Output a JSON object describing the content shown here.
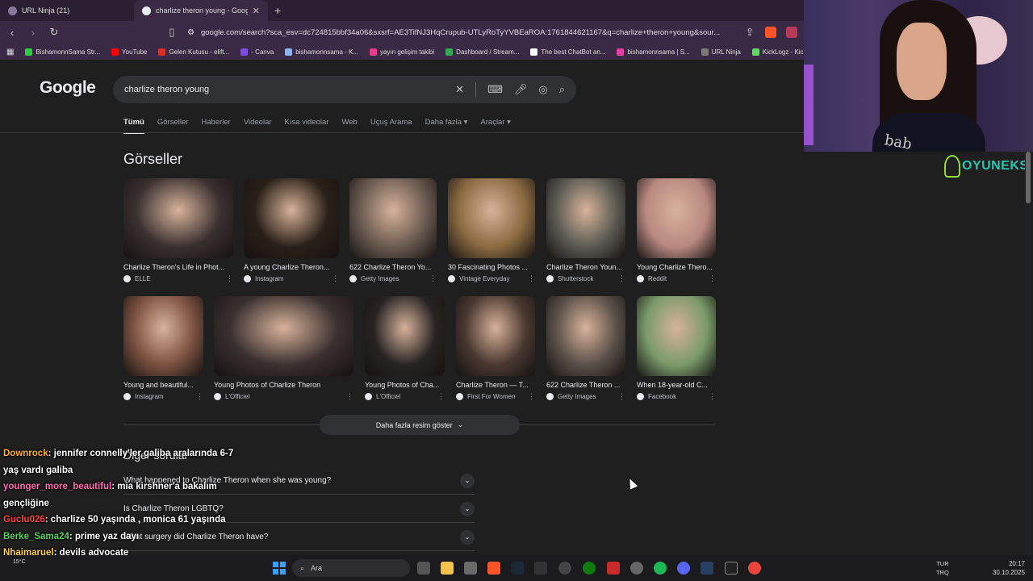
{
  "browser": {
    "tabs": [
      {
        "label": "URL Ninja (21)",
        "active": false
      },
      {
        "label": "charlize theron young - Google",
        "active": true
      }
    ],
    "url": "google.com/search?sca_esv=dc724815bbf34a06&sxsrf=AE3TifNJ3HqCrupub-UTLyRoTyYVBEaROA:1761844621167&q=charlize+theron+young&sour...",
    "bookmarks": [
      "BishamonnSama Str...",
      "YouTube",
      "Gelen Kutusu - elift...",
      "- Canva",
      "bishamonnsama - K...",
      "yayın gelişim takibi",
      "Dashboard / Stream...",
      "The best ChatBot an...",
      "bishamonnsama | S...",
      "URL Ninja",
      "KickLogz - Kick Yay"
    ],
    "bookmark_colors": [
      "#2ecc40",
      "#ff0000",
      "#d93025",
      "#7b4de0",
      "#8ab4f8",
      "#e83e8c",
      "#34a853",
      "#ffffff",
      "#e040a0",
      "#7a7a7a",
      "#6bd36b"
    ]
  },
  "google": {
    "logo": "Google",
    "query": "charlize theron young",
    "tabs": [
      "Tümü",
      "Görseller",
      "Haberler",
      "Videolar",
      "Kısa videolar",
      "Web",
      "Uçuş Arama",
      "Daha fazla ▾",
      "Araçlar ▾"
    ],
    "images_title": "Görseller",
    "images_row1": [
      {
        "caption": "Charlize Theron's Life in Phot...",
        "source": "ELLE",
        "color": "#3a3030"
      },
      {
        "caption": "A young Charlize Theron...",
        "source": "Instagram",
        "color": "#2a2018"
      },
      {
        "caption": "622 Charlize Theron Yo...",
        "source": "Getty Images",
        "color": "#6a5a50"
      },
      {
        "caption": "30 Fascinating Photos ...",
        "source": "Vintage Everyday",
        "color": "#8a6a40"
      },
      {
        "caption": "Charlize Theron Youn...",
        "source": "Shutterstock",
        "color": "#5a5a52"
      },
      {
        "caption": "Young Charlize Thero...",
        "source": "Reddit",
        "color": "#b88880"
      }
    ],
    "images_row2": [
      {
        "caption": "Young and beautiful...",
        "source": "Instagram",
        "color": "#7a5040"
      },
      {
        "caption": "Young Photos of Charlize Theron",
        "source": "L'Officiel",
        "color": "#3a3030"
      },
      {
        "caption": "Young Photos of Cha...",
        "source": "L'Officiel",
        "color": "#282424"
      },
      {
        "caption": "Charlize Theron — T...",
        "source": "First For Women",
        "color": "#4a3830"
      },
      {
        "caption": "622 Charlize Theron ...",
        "source": "Getty Images",
        "color": "#5a5048"
      },
      {
        "caption": "When 18-year-old C...",
        "source": "Facebook",
        "color": "#7a9a6a"
      }
    ],
    "more_images": "Daha fazla resim göster",
    "paa_title": "Diğer sorular",
    "questions": [
      "What happened to Charlize Theron when she was young?",
      "Is Charlize Theron LGBTQ?",
      "What surgery did Charlize Theron have?"
    ]
  },
  "chat": [
    {
      "user": "Downrock",
      "color": "#ffb020",
      "text": ": jennifer connelly'ler galiba aralarında 6-7 yaş vardı galiba"
    },
    {
      "user": "younger_more_beautiful",
      "color": "#ff6eb4",
      "text": ": mia kirshner'a bakalım gençliğine"
    },
    {
      "user": "Guclu026",
      "color": "#ff4040",
      "text": ": charlize 50 yaşında , monica 61 yaşında"
    },
    {
      "user": "Berke_Sama24",
      "color": "#5ad15a",
      "text": ": prime yaz dayı"
    },
    {
      "user": "Nhajmaruel",
      "color": "#ffd24a",
      "text": ": devils advocate"
    }
  ],
  "webcam": {
    "shirt_text": "bab"
  },
  "brand": "OYUNEKS",
  "taskbar": {
    "search": "Ara",
    "weather": "15°C",
    "lang": "TUR",
    "lang2": "TRQ",
    "time": "20:17",
    "date": "30.10.2025"
  }
}
